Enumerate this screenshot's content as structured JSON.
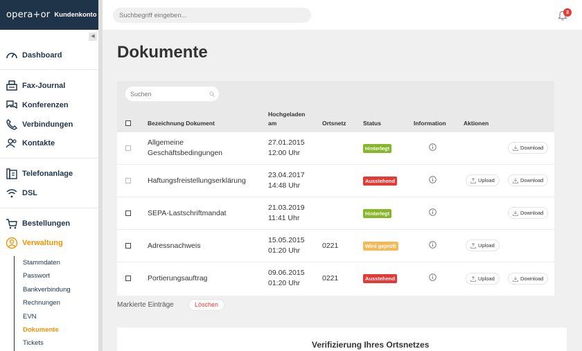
{
  "brand": {
    "logo": "opera+or",
    "subtitle": "Kundenkonto"
  },
  "sidebar": {
    "items": [
      {
        "label": "Dashboard",
        "icon": "speedometer-icon"
      },
      {
        "label": "Fax-Journal",
        "icon": "fax-icon"
      },
      {
        "label": "Konferenzen",
        "icon": "chat-icon"
      },
      {
        "label": "Verbindungen",
        "icon": "phone-icon"
      },
      {
        "label": "Kontakte",
        "icon": "contacts-icon"
      },
      {
        "label": "Telefonanlage",
        "icon": "pbx-icon"
      },
      {
        "label": "DSL",
        "icon": "wifi-icon"
      },
      {
        "label": "Bestellungen",
        "icon": "cart-icon"
      },
      {
        "label": "Verwaltung",
        "icon": "user-circle-icon"
      }
    ],
    "subitems": [
      "Stammdaten",
      "Passwort",
      "Bankverbindung",
      "Rechnungen",
      "EVN",
      "Dokumente",
      "Tickets"
    ]
  },
  "topbar": {
    "search_placeholder": "Suchbegriff eingeben...",
    "notification_count": "3"
  },
  "page": {
    "title": "Dokumente"
  },
  "table": {
    "search_placeholder": "Suchen",
    "headers": {
      "name": "Bezeichnung Dokument",
      "uploaded_1": "Hochgeladen",
      "uploaded_2": "am",
      "area": "Ortsnetz",
      "status": "Status",
      "info": "Information",
      "actions": "Aktionen"
    },
    "rows": [
      {
        "name1": "Allgemeine",
        "name2": "Geschäftsbedingungen",
        "date": "27.01.2015",
        "time": "12:00 Uhr",
        "area": "",
        "status": "Hinterlegt",
        "status_color": "#86b728"
      },
      {
        "name1": "Haftungsfreistellungserklärung",
        "name2": "",
        "date": "23.04.2017",
        "time": "14:48 Uhr",
        "area": "",
        "status": "Ausstehend",
        "status_color": "#e53935"
      },
      {
        "name1": "SEPA-Lastschriftmandat",
        "name2": "",
        "date": "21.03.2019",
        "time": "11:41 Uhr",
        "area": "",
        "status": "Hinterlegt",
        "status_color": "#86b728"
      },
      {
        "name1": "Adressnachweis",
        "name2": "",
        "date": "15.05.2015",
        "time": "01:20 Uhr",
        "area": "0221",
        "status": "Wird geprüft",
        "status_color": "#f5b95a"
      },
      {
        "name1": "Portierungsauftrag",
        "name2": "",
        "date": "09.06.2015",
        "time": "01:20 Uhr",
        "area": "0221",
        "status": "Ausstehend",
        "status_color": "#e53935"
      }
    ],
    "upload_label": "Upload",
    "download_label": "Download"
  },
  "bulk": {
    "label": "Markierte Einträge",
    "delete_label": "Löschen"
  },
  "verify": {
    "title": "Verifizierung Ihres Ortsnetzes"
  }
}
